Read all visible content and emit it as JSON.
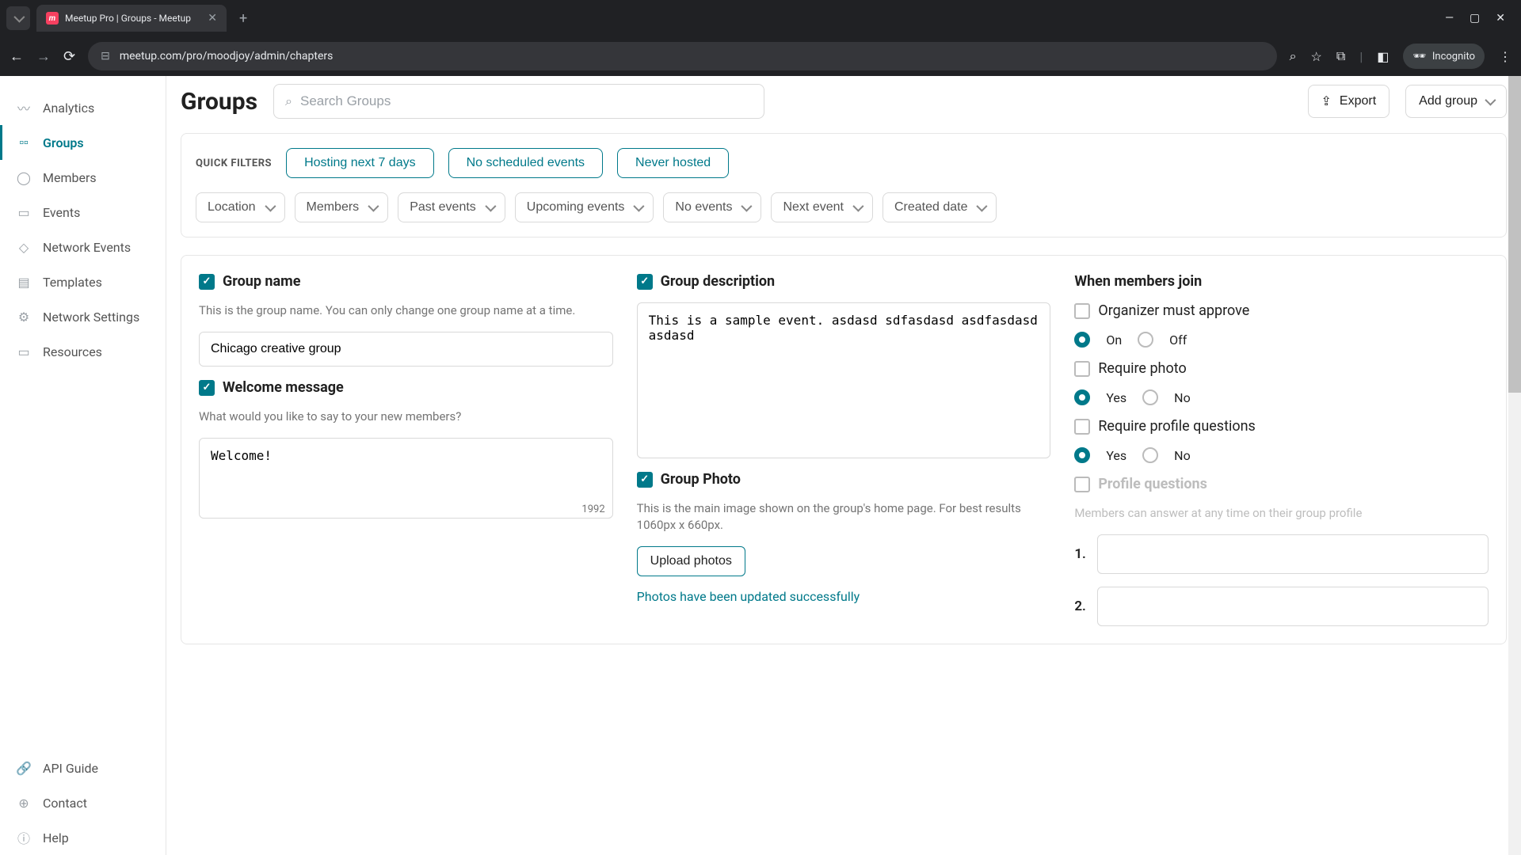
{
  "browser": {
    "tab_title": "Meetup Pro | Groups - Meetup",
    "url": "meetup.com/pro/moodjoy/admin/chapters",
    "incognito_label": "Incognito"
  },
  "sidebar": {
    "items": [
      {
        "label": "Analytics",
        "icon": "analytics"
      },
      {
        "label": "Groups",
        "icon": "groups",
        "active": true
      },
      {
        "label": "Members",
        "icon": "members"
      },
      {
        "label": "Events",
        "icon": "events"
      },
      {
        "label": "Network Events",
        "icon": "network-events"
      },
      {
        "label": "Templates",
        "icon": "templates"
      },
      {
        "label": "Network Settings",
        "icon": "settings"
      },
      {
        "label": "Resources",
        "icon": "resources"
      }
    ],
    "footer": [
      {
        "label": "API Guide",
        "icon": "link"
      },
      {
        "label": "Contact",
        "icon": "contact"
      },
      {
        "label": "Help",
        "icon": "help"
      }
    ]
  },
  "header": {
    "title": "Groups",
    "search_placeholder": "Search Groups",
    "export_label": "Export",
    "add_group_label": "Add group"
  },
  "filters": {
    "quick_label": "QUICK FILTERS",
    "quick": [
      "Hosting next 7 days",
      "No scheduled events",
      "Never hosted"
    ],
    "chips": [
      "Location",
      "Members",
      "Past events",
      "Upcoming events",
      "No events",
      "Next event",
      "Created date"
    ]
  },
  "form": {
    "group_name": {
      "title": "Group name",
      "helper": "This is the group name. You can only change one group name at a time.",
      "value": "Chicago creative group"
    },
    "welcome_message": {
      "title": "Welcome message",
      "helper": "What would you like to say to your new members?",
      "value": "Welcome!",
      "char_count": "1992"
    },
    "group_description": {
      "title": "Group description",
      "value": "This is a sample event. asdasd sdfasdasd asdfasdasd asdasd"
    },
    "group_photo": {
      "title": "Group Photo",
      "helper": "This is the main image shown on the group's home page. For best results 1060px x 660px.",
      "button": "Upload photos",
      "success": "Photos have been updated successfully"
    },
    "join": {
      "title": "When members join",
      "organizer_approve": "Organizer must approve",
      "on": "On",
      "off": "Off",
      "require_photo": "Require photo",
      "yes": "Yes",
      "no": "No",
      "require_questions": "Require profile questions",
      "profile_questions": "Profile questions",
      "profile_helper": "Members can answer at any time on their group profile",
      "q1": "1.",
      "q2": "2."
    }
  }
}
